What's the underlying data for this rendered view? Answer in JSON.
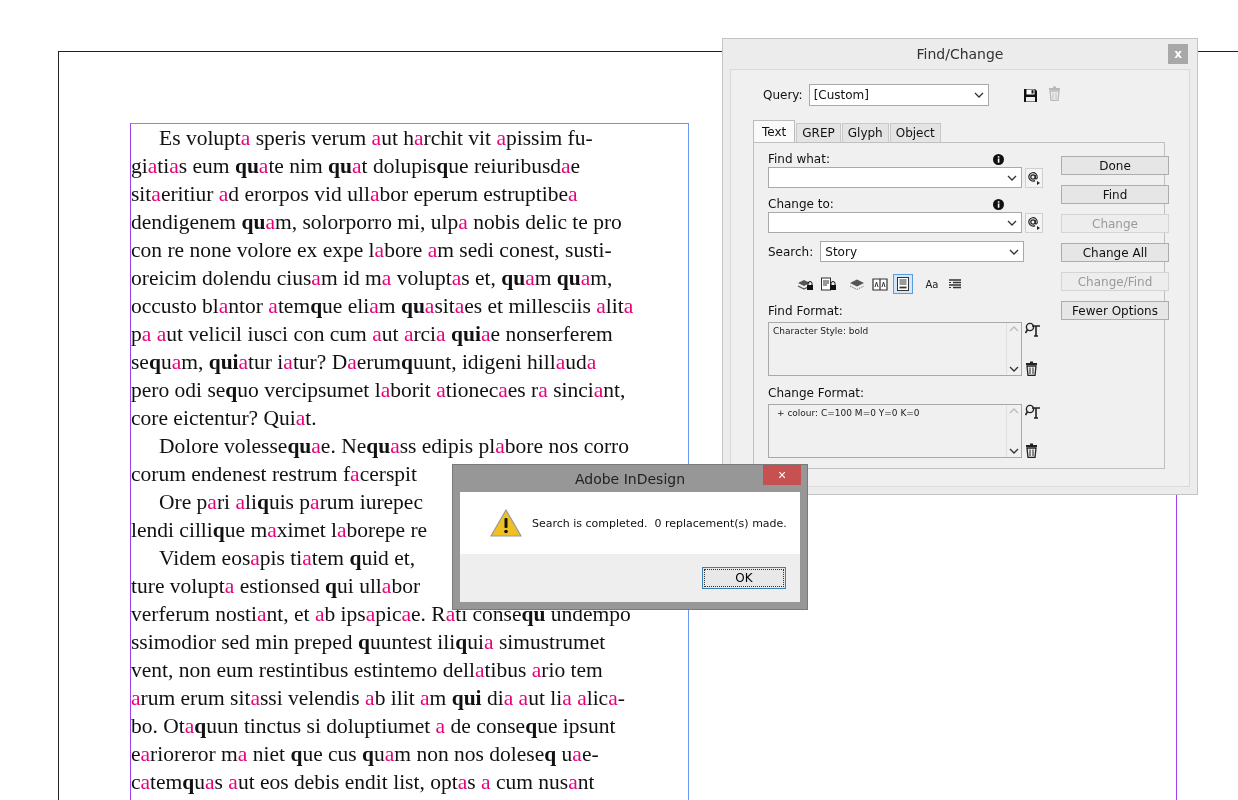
{
  "document": {
    "lines": [
      {
        "paragraph_start": true,
        "segments": [
          {
            "text": "Es volupt"
          },
          {
            "text": "a",
            "color": "#e6007e"
          },
          {
            "text": " speris verum "
          },
          {
            "text": "a",
            "color": "#e6007e"
          },
          {
            "text": "ut h"
          },
          {
            "text": "a",
            "color": "#e6007e"
          },
          {
            "text": "rchit vit "
          },
          {
            "text": "a",
            "color": "#e6007e"
          },
          {
            "text": "pissim fu-"
          }
        ]
      },
      {
        "paragraph_start": false,
        "segments": [
          {
            "text": "gi"
          },
          {
            "text": "a",
            "color": "#e6007e"
          },
          {
            "text": "ti"
          },
          {
            "text": "a",
            "color": "#e6007e"
          },
          {
            "text": "s eum **qu**"
          },
          {
            "text": "a",
            "color": "#e6007e"
          },
          {
            "text": "te nim **qu**"
          },
          {
            "text": "a",
            "color": "#e6007e"
          },
          {
            "text": "t dolupis**q**ue reiuribusd"
          },
          {
            "text": "a",
            "color": "#e6007e"
          },
          {
            "text": "e"
          }
        ]
      },
      {
        "paragraph_start": false,
        "segments": [
          {
            "text": "sit"
          },
          {
            "text": "a",
            "color": "#e6007e"
          },
          {
            "text": "eritiur "
          },
          {
            "text": "a",
            "color": "#e6007e"
          },
          {
            "text": "d erorpos vid ull"
          },
          {
            "text": "a",
            "color": "#e6007e"
          },
          {
            "text": "bor eperum estruptibe"
          },
          {
            "text": "a",
            "color": "#e6007e"
          }
        ]
      },
      {
        "paragraph_start": false,
        "segments": [
          {
            "text": "dendigenem **qu**"
          },
          {
            "text": "a",
            "color": "#e6007e"
          },
          {
            "text": "m, solorporro mi, ulp"
          },
          {
            "text": "a",
            "color": "#e6007e"
          },
          {
            "text": " nobis delic te pro"
          }
        ]
      },
      {
        "paragraph_start": false,
        "segments": [
          {
            "text": "con re none volore ex expe l"
          },
          {
            "text": "a",
            "color": "#e6007e"
          },
          {
            "text": "bore "
          },
          {
            "text": "a",
            "color": "#e6007e"
          },
          {
            "text": "m sedi conest, susti-"
          }
        ]
      },
      {
        "paragraph_start": false,
        "segments": [
          {
            "text": "oreicim dolendu cius"
          },
          {
            "text": "a",
            "color": "#e6007e"
          },
          {
            "text": "m id m"
          },
          {
            "text": "a",
            "color": "#e6007e"
          },
          {
            "text": " volupt"
          },
          {
            "text": "a",
            "color": "#e6007e"
          },
          {
            "text": "s et, **qu**"
          },
          {
            "text": "a",
            "color": "#e6007e"
          },
          {
            "text": "m **qu**"
          },
          {
            "text": "a",
            "color": "#e6007e"
          },
          {
            "text": "m,"
          }
        ]
      },
      {
        "paragraph_start": false,
        "segments": [
          {
            "text": "occusto bl"
          },
          {
            "text": "a",
            "color": "#e6007e"
          },
          {
            "text": "ntor "
          },
          {
            "text": "a",
            "color": "#e6007e"
          },
          {
            "text": "tem**q**ue eli"
          },
          {
            "text": "a",
            "color": "#e6007e"
          },
          {
            "text": "m **qu**"
          },
          {
            "text": "a",
            "color": "#e6007e"
          },
          {
            "text": "sit"
          },
          {
            "text": "a",
            "color": "#e6007e"
          },
          {
            "text": "es et millesciis "
          },
          {
            "text": "a",
            "color": "#e6007e"
          },
          {
            "text": "lit"
          },
          {
            "text": "a",
            "color": "#e6007e"
          }
        ]
      },
      {
        "paragraph_start": false,
        "segments": [
          {
            "text": "p"
          },
          {
            "text": "a ",
            "color": "#e6007e"
          },
          {
            "text": "a",
            "color": "#e6007e"
          },
          {
            "text": "ut velicil iusci con cum "
          },
          {
            "text": "a",
            "color": "#e6007e"
          },
          {
            "text": "ut "
          },
          {
            "text": "a",
            "color": "#e6007e"
          },
          {
            "text": "rci"
          },
          {
            "text": "a",
            "color": "#e6007e"
          },
          {
            "text": " **qui**"
          },
          {
            "text": "a",
            "color": "#e6007e"
          },
          {
            "text": "e nonserferem"
          }
        ]
      },
      {
        "paragraph_start": false,
        "segments": [
          {
            "text": "se**q**u"
          },
          {
            "text": "a",
            "color": "#e6007e"
          },
          {
            "text": "m, **qui**"
          },
          {
            "text": "a",
            "color": "#e6007e"
          },
          {
            "text": "tur i"
          },
          {
            "text": "a",
            "color": "#e6007e"
          },
          {
            "text": "tur? D"
          },
          {
            "text": "a",
            "color": "#e6007e"
          },
          {
            "text": "erum**q**uunt, idigeni hill"
          },
          {
            "text": "a",
            "color": "#e6007e"
          },
          {
            "text": "ud"
          },
          {
            "text": "a",
            "color": "#e6007e"
          }
        ]
      },
      {
        "paragraph_start": false,
        "segments": [
          {
            "text": "pero odi se**q**uo vercipsumet l"
          },
          {
            "text": "a",
            "color": "#e6007e"
          },
          {
            "text": "borit "
          },
          {
            "text": "a",
            "color": "#e6007e"
          },
          {
            "text": "tionec"
          },
          {
            "text": "a",
            "color": "#e6007e"
          },
          {
            "text": "es r"
          },
          {
            "text": "a",
            "color": "#e6007e"
          },
          {
            "text": " sinci"
          },
          {
            "text": "a",
            "color": "#e6007e"
          },
          {
            "text": "nt,"
          }
        ]
      },
      {
        "paragraph_start": false,
        "segments": [
          {
            "text": "core eictentur? Qui"
          },
          {
            "text": "a",
            "color": "#e6007e"
          },
          {
            "text": "t."
          }
        ]
      },
      {
        "paragraph_start": true,
        "segments": [
          {
            "text": "Dolore volesse**qu**"
          },
          {
            "text": "a",
            "color": "#e6007e"
          },
          {
            "text": "e. Ne**qu**"
          },
          {
            "text": "a",
            "color": "#e6007e"
          },
          {
            "text": "ss edipis pl"
          },
          {
            "text": "a",
            "color": "#e6007e"
          },
          {
            "text": "bore nos corro"
          }
        ]
      },
      {
        "paragraph_start": false,
        "segments": [
          {
            "text": "corum endenest restrum f"
          },
          {
            "text": "a",
            "color": "#e6007e"
          },
          {
            "text": "cerspit"
          }
        ]
      },
      {
        "paragraph_start": true,
        "segments": [
          {
            "text": "Ore p"
          },
          {
            "text": "a",
            "color": "#e6007e"
          },
          {
            "text": "ri "
          },
          {
            "text": "a",
            "color": "#e6007e"
          },
          {
            "text": "li**q**uis p"
          },
          {
            "text": "a",
            "color": "#e6007e"
          },
          {
            "text": "rum iurepec"
          }
        ]
      },
      {
        "paragraph_start": false,
        "segments": [
          {
            "text": "lendi cilli**q**ue m"
          },
          {
            "text": "a",
            "color": "#e6007e"
          },
          {
            "text": "ximet l"
          },
          {
            "text": "a",
            "color": "#e6007e"
          },
          {
            "text": "borepe re"
          }
        ]
      },
      {
        "paragraph_start": true,
        "segments": [
          {
            "text": "Videm eos"
          },
          {
            "text": "a",
            "color": "#e6007e"
          },
          {
            "text": "pis ti"
          },
          {
            "text": "a",
            "color": "#e6007e"
          },
          {
            "text": "tem **q**uid et,"
          }
        ]
      },
      {
        "paragraph_start": false,
        "segments": [
          {
            "text": "ture volupt"
          },
          {
            "text": "a",
            "color": "#e6007e"
          },
          {
            "text": " estionsed **q**ui ull"
          },
          {
            "text": "a",
            "color": "#e6007e"
          },
          {
            "text": "bor"
          }
        ]
      },
      {
        "paragraph_start": false,
        "segments": [
          {
            "text": "verferum nosti"
          },
          {
            "text": "a",
            "color": "#e6007e"
          },
          {
            "text": "nt, et "
          },
          {
            "text": "a",
            "color": "#e6007e"
          },
          {
            "text": "b ips"
          },
          {
            "text": "a",
            "color": "#e6007e"
          },
          {
            "text": "pic"
          },
          {
            "text": "a",
            "color": "#e6007e"
          },
          {
            "text": "e. R"
          },
          {
            "text": "a",
            "color": "#e6007e"
          },
          {
            "text": "ti conse**qu** undempo"
          }
        ]
      },
      {
        "paragraph_start": false,
        "segments": [
          {
            "text": "ssimodior sed min preped **q**uuntest ili**q**ui"
          },
          {
            "text": "a",
            "color": "#e6007e"
          },
          {
            "text": " simustrumet"
          }
        ]
      },
      {
        "paragraph_start": false,
        "segments": [
          {
            "text": "vent, non eum restintibus estintemo dell"
          },
          {
            "text": "a",
            "color": "#e6007e"
          },
          {
            "text": "tibus "
          },
          {
            "text": "a",
            "color": "#e6007e"
          },
          {
            "text": "rio tem"
          }
        ]
      },
      {
        "paragraph_start": false,
        "segments": [
          {
            "text": "a",
            "color": "#e6007e"
          },
          {
            "text": "rum erum sit"
          },
          {
            "text": "a",
            "color": "#e6007e"
          },
          {
            "text": "ssi velendis "
          },
          {
            "text": "a",
            "color": "#e6007e"
          },
          {
            "text": "b ilit "
          },
          {
            "text": "a",
            "color": "#e6007e"
          },
          {
            "text": "m **qui** di"
          },
          {
            "text": "a ",
            "color": "#e6007e"
          },
          {
            "text": "a",
            "color": "#e6007e"
          },
          {
            "text": "ut li"
          },
          {
            "text": "a ",
            "color": "#e6007e"
          },
          {
            "text": "a",
            "color": "#e6007e"
          },
          {
            "text": "lic"
          },
          {
            "text": "a",
            "color": "#e6007e"
          },
          {
            "text": "-"
          }
        ]
      },
      {
        "paragraph_start": false,
        "segments": [
          {
            "text": "bo. Ot"
          },
          {
            "text": "a",
            "color": "#e6007e"
          },
          {
            "text": "**q**uun tinctus si doluptiumet "
          },
          {
            "text": "a",
            "color": "#e6007e"
          },
          {
            "text": " de conse**q**ue ipsunt"
          }
        ]
      },
      {
        "paragraph_start": false,
        "segments": [
          {
            "text": "e"
          },
          {
            "text": "a",
            "color": "#e6007e"
          },
          {
            "text": "rioreror m"
          },
          {
            "text": "a",
            "color": "#e6007e"
          },
          {
            "text": " niet **q**ue cus **q**u"
          },
          {
            "text": "a",
            "color": "#e6007e"
          },
          {
            "text": "m non nos dolese**q** u"
          },
          {
            "text": "a",
            "color": "#e6007e"
          },
          {
            "text": "e-"
          }
        ]
      },
      {
        "paragraph_start": false,
        "segments": [
          {
            "text": "c"
          },
          {
            "text": "a",
            "color": "#e6007e"
          },
          {
            "text": "tem**q**u"
          },
          {
            "text": "a",
            "color": "#e6007e"
          },
          {
            "text": "s "
          },
          {
            "text": "a",
            "color": "#e6007e"
          },
          {
            "text": "ut eos debis endit list, opt"
          },
          {
            "text": "a",
            "color": "#e6007e"
          },
          {
            "text": "s "
          },
          {
            "text": "a",
            "color": "#e6007e"
          },
          {
            "text": " cum nus"
          },
          {
            "text": "a",
            "color": "#e6007e"
          },
          {
            "text": "nt"
          }
        ]
      }
    ]
  },
  "find_change": {
    "title": "Find/Change",
    "close": "x",
    "query_label": "Query:",
    "query_value": "[Custom]",
    "tabs": [
      {
        "label": "Text",
        "selected": true
      },
      {
        "label": "GREP",
        "selected": false
      },
      {
        "label": "Glyph",
        "selected": false
      },
      {
        "label": "Object",
        "selected": false
      }
    ],
    "find_what_label": "Find what:",
    "change_to_label": "Change to:",
    "search_label": "Search:",
    "search_value": "Story",
    "options": [
      {
        "kind": "locked-layers",
        "selected": false
      },
      {
        "kind": "locked-stories",
        "selected": false
      },
      {
        "kind": "hidden-layers",
        "selected": false
      },
      {
        "kind": "master-pages",
        "selected": false
      },
      {
        "kind": "footnotes",
        "selected": true
      },
      {
        "kind": "text",
        "label": "Aa",
        "selected": false
      },
      {
        "kind": "whole-word",
        "selected": false
      }
    ],
    "find_format_label": "Find Format:",
    "find_format": "Character Style: bold",
    "change_format_label": "Change Format:",
    "change_format": "+ colour: C=100 M=0 Y=0 K=0",
    "buttons": [
      {
        "label": "Done",
        "disabled": false
      },
      {
        "label": "Find",
        "disabled": false
      },
      {
        "label": "Change",
        "disabled": true
      },
      {
        "label": "Change All",
        "disabled": false
      },
      {
        "label": "Change/Find",
        "disabled": true
      },
      {
        "label": "Fewer Options",
        "disabled": false
      }
    ]
  },
  "alert": {
    "title": "Adobe InDesign",
    "close": "×",
    "message": "Search is completed.  0 replacement(s) made.",
    "ok": "OK"
  }
}
